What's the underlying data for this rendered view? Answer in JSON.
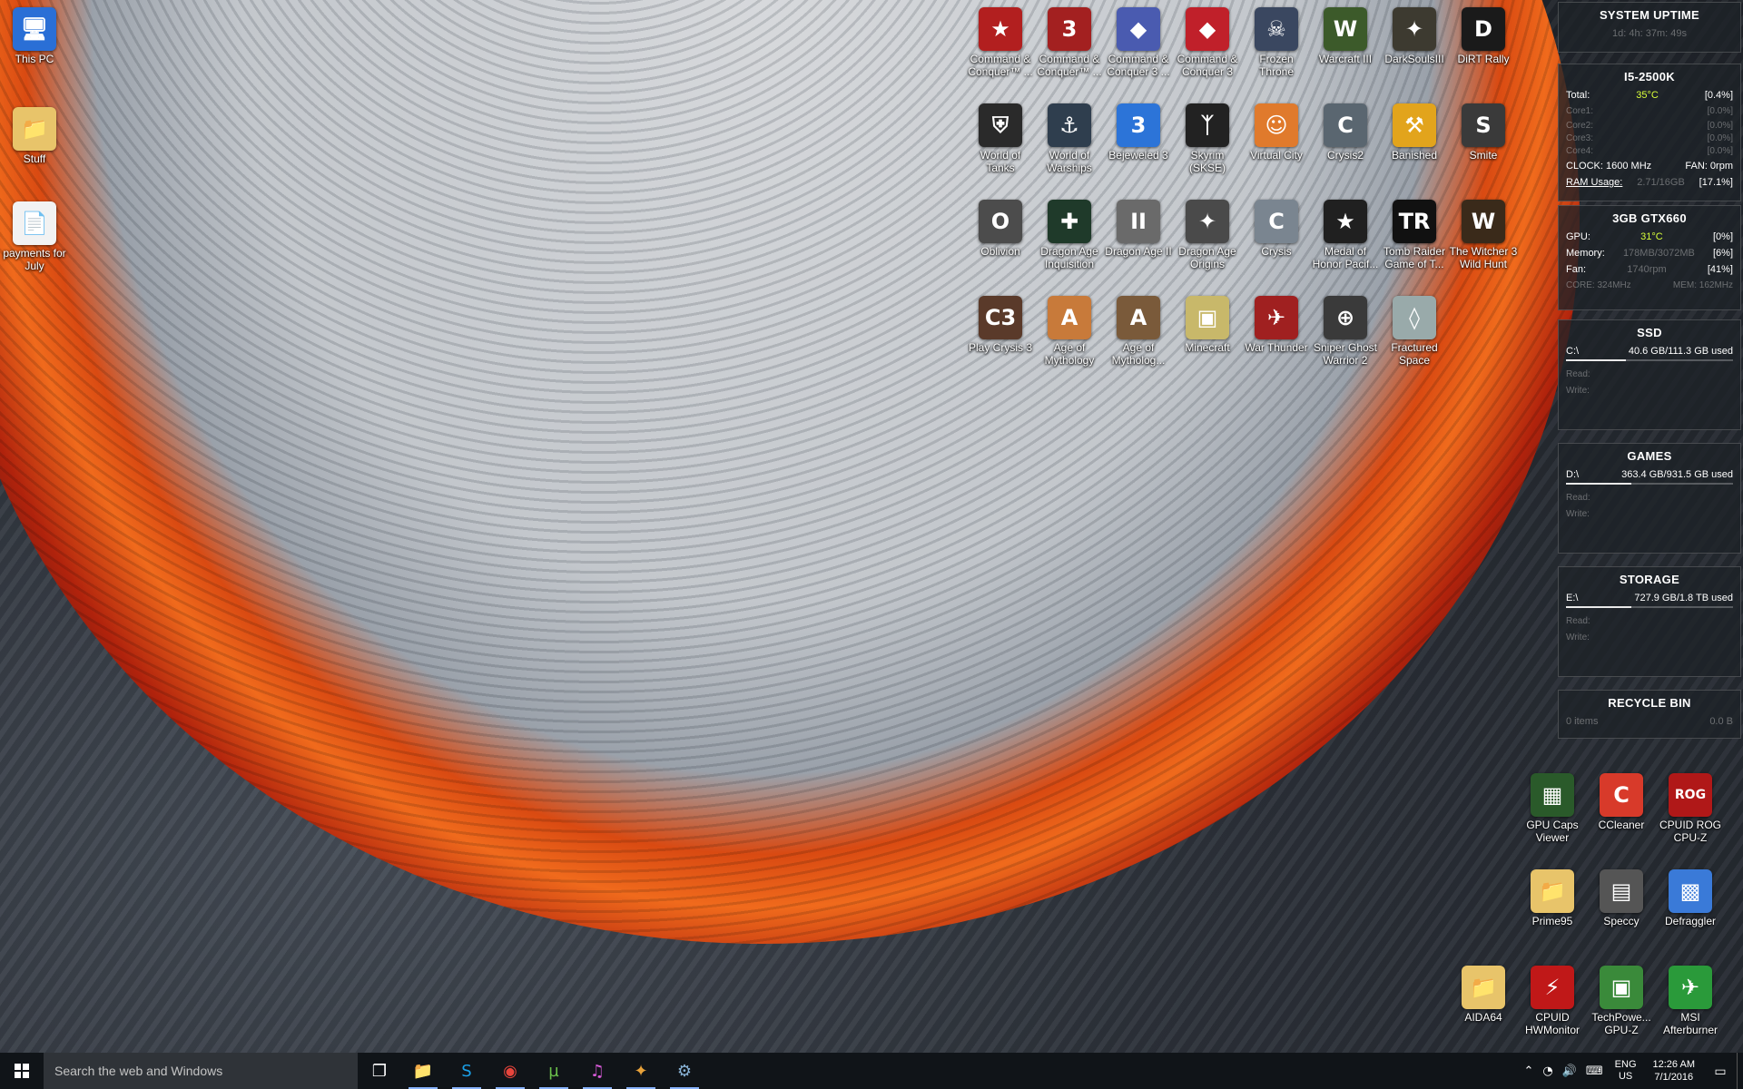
{
  "desktop_icons": [
    {
      "label": "This PC",
      "icon": "pc-icon",
      "glyph": "🖥",
      "bg": "#2a6fd6"
    },
    {
      "label": "Stuff",
      "icon": "folder-icon",
      "glyph": "📁",
      "bg": "#e8c46a"
    },
    {
      "label": "payments for July",
      "icon": "document-icon",
      "glyph": "📄",
      "bg": "#f2f2f2"
    },
    {
      "label": "Command & Conquer™ ...",
      "icon": "cnc-icon",
      "glyph": "★",
      "bg": "#b21f1f"
    },
    {
      "label": "Command & Conquer™ ...",
      "icon": "cnc3-icon",
      "glyph": "3",
      "bg": "#a32020"
    },
    {
      "label": "Command & Conquer 3 ...",
      "icon": "cnc-kanes-wrath-icon",
      "glyph": "◆",
      "bg": "#4a5bb0"
    },
    {
      "label": "Command & Conquer 3",
      "icon": "cnc-tiberium-icon",
      "glyph": "◆",
      "bg": "#c0202a"
    },
    {
      "label": "Frozen Throne",
      "icon": "frozen-throne-icon",
      "glyph": "☠",
      "bg": "#3a4760"
    },
    {
      "label": "Warcraft III",
      "icon": "warcraft-icon",
      "glyph": "W",
      "bg": "#3c5a2a"
    },
    {
      "label": "DarkSoulsIII",
      "icon": "darksouls-icon",
      "glyph": "✦",
      "bg": "#3d3a30"
    },
    {
      "label": "DiRT Rally",
      "icon": "dirt-rally-icon",
      "glyph": "D",
      "bg": "#1a1a1a"
    },
    {
      "label": "World of Tanks",
      "icon": "world-of-tanks-icon",
      "glyph": "⛨",
      "bg": "#2a2a2a"
    },
    {
      "label": "World of Warships",
      "icon": "world-of-warships-icon",
      "glyph": "⚓",
      "bg": "#2f3e4e"
    },
    {
      "label": "Bejeweled 3",
      "icon": "bejeweled-icon",
      "glyph": "3",
      "bg": "#2c74d8"
    },
    {
      "label": "Skyrim (SKSE)",
      "icon": "skyrim-icon",
      "glyph": "ᛉ",
      "bg": "#222"
    },
    {
      "label": "Virtual City",
      "icon": "virtual-city-icon",
      "glyph": "☺",
      "bg": "#e07a2c"
    },
    {
      "label": "Crysis2",
      "icon": "crysis2-icon",
      "glyph": "C",
      "bg": "#5a6670"
    },
    {
      "label": "Banished",
      "icon": "banished-icon",
      "glyph": "⚒",
      "bg": "#e2a41c"
    },
    {
      "label": "Smite",
      "icon": "smite-icon",
      "glyph": "S",
      "bg": "#3a3a3a"
    },
    {
      "label": "Oblivion",
      "icon": "oblivion-icon",
      "glyph": "O",
      "bg": "#4c4c4c"
    },
    {
      "label": "Dragon Age Inquisition",
      "icon": "dragon-age-inquisition-icon",
      "glyph": "✚",
      "bg": "#1f3a2a"
    },
    {
      "label": "Dragon Age II",
      "icon": "dragon-age-2-icon",
      "glyph": "II",
      "bg": "#6a6a6a"
    },
    {
      "label": "Dragon Age Origins",
      "icon": "dragon-age-origins-icon",
      "glyph": "✦",
      "bg": "#4a4a4a"
    },
    {
      "label": "Crysis",
      "icon": "crysis-icon",
      "glyph": "C",
      "bg": "#7a8590"
    },
    {
      "label": "Medal of Honor Pacif...",
      "icon": "medal-of-honor-icon",
      "glyph": "★",
      "bg": "#202020"
    },
    {
      "label": "Tomb Raider Game of T...",
      "icon": "tomb-raider-icon",
      "glyph": "TR",
      "bg": "#111"
    },
    {
      "label": "The Witcher 3 Wild Hunt",
      "icon": "witcher-icon",
      "glyph": "W",
      "bg": "#3a2a1a"
    },
    {
      "label": "Play Crysis 3",
      "icon": "crysis3-icon",
      "glyph": "C3",
      "bg": "#5a3a2a"
    },
    {
      "label": "Age of Mythology",
      "icon": "age-of-mythology-icon",
      "glyph": "A",
      "bg": "#c87a3a"
    },
    {
      "label": "Age of Mytholog...",
      "icon": "age-of-mythology-2-icon",
      "glyph": "A",
      "bg": "#7a5a3a"
    },
    {
      "label": "Minecraft",
      "icon": "minecraft-icon",
      "glyph": "▣",
      "bg": "#c8b86a"
    },
    {
      "label": "War Thunder",
      "icon": "war-thunder-icon",
      "glyph": "✈",
      "bg": "#a02020"
    },
    {
      "label": "Sniper Ghost Warrior 2",
      "icon": "sniper-icon",
      "glyph": "⊕",
      "bg": "#3a3a3a"
    },
    {
      "label": "Fractured Space",
      "icon": "fractured-space-icon",
      "glyph": "◊",
      "bg": "#9aa"
    },
    {
      "label": "GPU Caps Viewer",
      "icon": "gpu-caps-icon",
      "glyph": "▦",
      "bg": "#2a5a2a"
    },
    {
      "label": "CCleaner",
      "icon": "ccleaner-icon",
      "glyph": "C",
      "bg": "#d83a2a"
    },
    {
      "label": "CPUID ROG CPU-Z",
      "icon": "cpuz-rog-icon",
      "glyph": "ROG",
      "bg": "#b01818"
    },
    {
      "label": "Prime95",
      "icon": "prime95-icon",
      "glyph": "📁",
      "bg": "#e8c46a"
    },
    {
      "label": "Speccy",
      "icon": "speccy-icon",
      "glyph": "▤",
      "bg": "#555"
    },
    {
      "label": "Defraggler",
      "icon": "defraggler-icon",
      "glyph": "▩",
      "bg": "#3a7ad8"
    },
    {
      "label": "AIDA64",
      "icon": "aida64-icon",
      "glyph": "📁",
      "bg": "#e8c46a"
    },
    {
      "label": "CPUID HWMonitor",
      "icon": "hwmonitor-icon",
      "glyph": "⚡",
      "bg": "#c01818"
    },
    {
      "label": "TechPowe... GPU-Z",
      "icon": "gpuz-icon",
      "glyph": "▣",
      "bg": "#3a8a3a"
    },
    {
      "label": "MSI Afterburner",
      "icon": "afterburner-icon",
      "glyph": "✈",
      "bg": "#2a9a3a"
    }
  ],
  "gauges": {
    "uptime": {
      "title": "SYSTEM UPTIME",
      "value": "1d: 4h: 37m: 49s"
    },
    "cpu": {
      "title": "I5-2500K",
      "total_label": "Total:",
      "temp": "35°C",
      "load": "[0.4%]",
      "cores": [
        "Core1:",
        "Core2:",
        "Core3:",
        "Core4:"
      ],
      "core_loads": [
        "[0.0%]",
        "[0.0%]",
        "[0.0%]",
        "[0.0%]"
      ],
      "clock": "CLOCK: 1600 MHz",
      "fan": "FAN: 0rpm",
      "ram_label": "RAM Usage:",
      "ram_value": "2.71/16GB",
      "ram_pct": "[17.1%]"
    },
    "gpu": {
      "title": "3GB GTX660",
      "gpu_label": "GPU:",
      "temp": "31°C",
      "load": "[0%]",
      "mem_label": "Memory:",
      "mem_value": "178MB/3072MB",
      "mem_pct": "[6%]",
      "fan_label": "Fan:",
      "fan_value": "1740rpm",
      "fan_pct": "[41%]",
      "core_clock": "CORE: 324MHz",
      "mem_clock": "MEM: 162MHz"
    },
    "ssd": {
      "title": "SSD",
      "drive": "C:\\",
      "used": "40.6 GB/111.3 GB used",
      "read_label": "Read:",
      "write_label": "Write:",
      "fill": 0.36
    },
    "games": {
      "title": "GAMES",
      "drive": "D:\\",
      "used": "363.4 GB/931.5 GB used",
      "read_label": "Read:",
      "write_label": "Write:",
      "fill": 0.39
    },
    "storage": {
      "title": "STORAGE",
      "drive": "E:\\",
      "used": "727.9 GB/1.8 TB used",
      "read_label": "Read:",
      "write_label": "Write:",
      "fill": 0.39
    },
    "recycle": {
      "title": "RECYCLE BIN",
      "items": "0 items",
      "size": "0.0 B"
    }
  },
  "taskbar": {
    "search_placeholder": "Search the web and Windows",
    "apps": [
      {
        "name": "task-view-icon",
        "glyph": "❐",
        "color": "#ffffff"
      },
      {
        "name": "file-explorer-icon",
        "glyph": "📁",
        "color": "#f2c94c"
      },
      {
        "name": "skype-icon",
        "glyph": "S",
        "color": "#1aa0e8"
      },
      {
        "name": "chrome-icon",
        "glyph": "◉",
        "color": "#e8453c"
      },
      {
        "name": "utorrent-icon",
        "glyph": "µ",
        "color": "#6bc04b"
      },
      {
        "name": "itunes-icon",
        "glyph": "♫",
        "color": "#d85ad8"
      },
      {
        "name": "bitwarden-icon",
        "glyph": "✦",
        "color": "#e8a23a"
      },
      {
        "name": "steam-icon",
        "glyph": "⚙",
        "color": "#8ab4d8"
      }
    ],
    "lang_top": "ENG",
    "lang_bottom": "US",
    "time": "12:26 AM",
    "date": "7/1/2016"
  }
}
